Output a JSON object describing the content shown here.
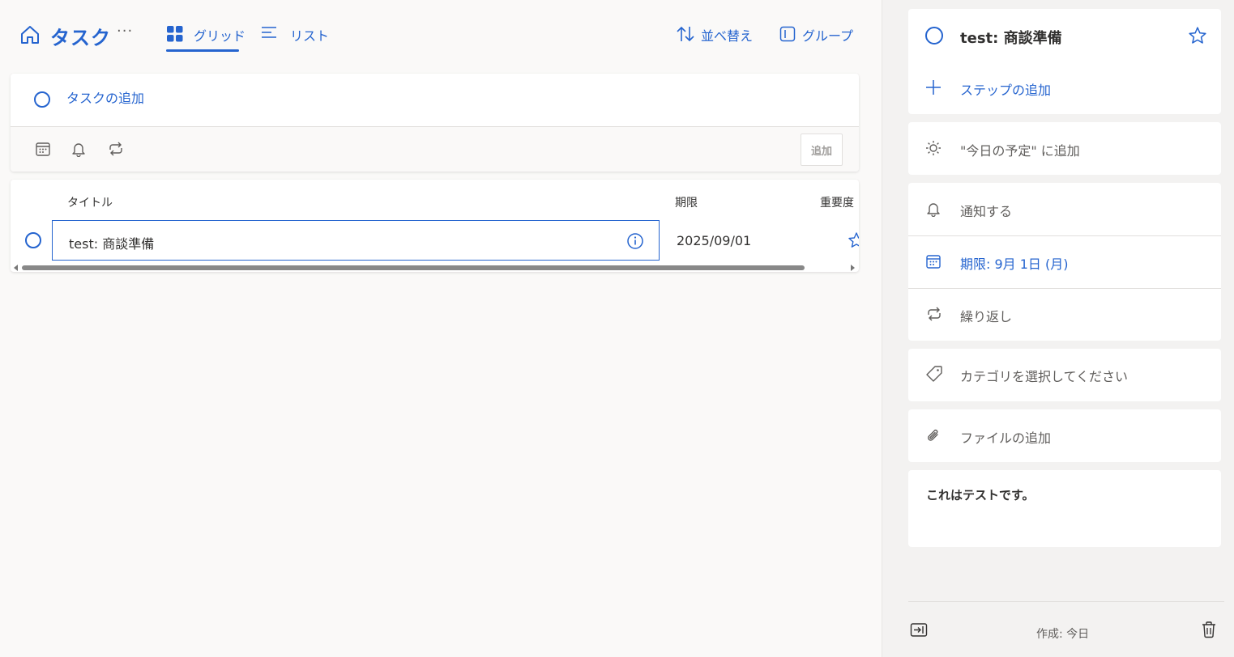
{
  "header": {
    "title": "タスク",
    "more": "···",
    "tabs": [
      {
        "label": "グリッド",
        "icon": "grid-icon",
        "active": true
      },
      {
        "label": "リスト",
        "icon": "list-icon",
        "active": false
      }
    ],
    "sort_label": "並べ替え",
    "group_label": "グループ"
  },
  "add_task": {
    "placeholder": "タスクの追加",
    "add_button": "追加"
  },
  "grid": {
    "columns": [
      "タイトル",
      "期限",
      "重要度"
    ],
    "rows": [
      {
        "title": "test: 商談準備",
        "due": "2025/09/01",
        "important": false
      }
    ]
  },
  "detail": {
    "title": "test: 商談準備",
    "add_step": "ステップの追加",
    "add_to_today": "\"今日の予定\" に追加",
    "remind": "通知する",
    "due": "期限: 9月 1日 (月)",
    "repeat": "繰り返し",
    "category": "カテゴリを選択してください",
    "add_file": "ファイルの追加",
    "note": "これはテストです。",
    "created": "作成: 今日"
  },
  "colors": {
    "accent": "#2564cf",
    "background": "#faf9f8",
    "panel": "#f3f2f1"
  }
}
